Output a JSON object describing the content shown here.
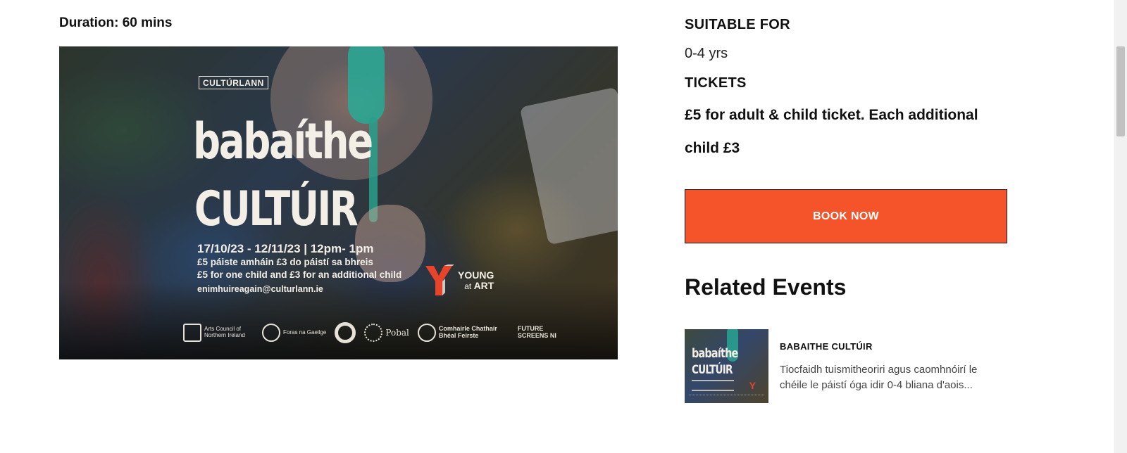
{
  "event": {
    "duration": "Duration: 60 mins"
  },
  "poster": {
    "logo": "CULTÚRLANN",
    "title_line1": "babaíthe",
    "title_line2": "CULTÚIR",
    "dates": "17/10/23 - 12/11/23 | 12pm- 1pm",
    "info_irish": "£5 páiste amháin £3 do páistí sa bhreis",
    "info_english": "£5 for one child and £3 for an additional child",
    "email": "enimhuireagain@culturlann.ie",
    "young_at_art": {
      "young": "YOUNG",
      "at": "at",
      "art": "ART"
    },
    "sponsors": [
      {
        "name": "arts council",
        "caption": "Arts Council of Northern Ireland"
      },
      {
        "name": "Foras na Gaeilge",
        "caption": "Foras na Gaeilge"
      },
      {
        "name": "Pobal",
        "caption": "Pobal"
      },
      {
        "name": "Comhairle Chathair Bhéal Feirste",
        "caption": "Comhairle Chathair Bhéal Feirste"
      },
      {
        "name": "FUTURE SCREENS NI",
        "caption": "FUTURE SCREENS NI"
      }
    ]
  },
  "details": {
    "suitable_label": "SUITABLE FOR",
    "suitable_value": "0-4 yrs",
    "tickets_label": "TICKETS",
    "tickets_value": "£5 for adult & child ticket. Each additional child £3",
    "book_label": "BOOK NOW"
  },
  "related": {
    "title": "Related Events",
    "items": [
      {
        "name": "BABAITHE CULTÚIR",
        "description": "Tiocfaidh tuismitheoriri agus caomhnóirí le chéile le páistí óga idir 0-4 bliana d'aois..."
      }
    ]
  },
  "colors": {
    "accent": "#f5532a",
    "text": "#111111"
  }
}
